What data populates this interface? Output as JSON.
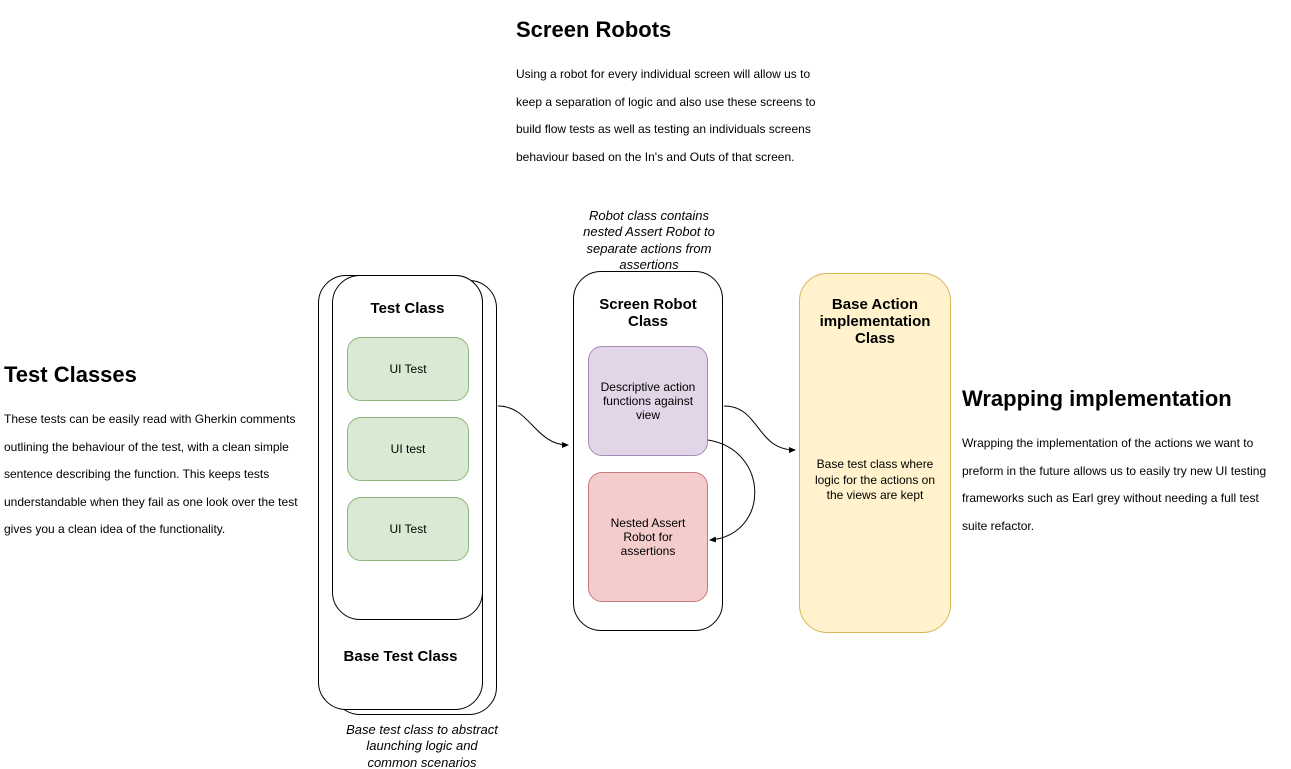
{
  "screenRobots": {
    "title": "Screen Robots",
    "body": "Using a robot for every individual screen will allow us to keep a separation of logic and also use these screens to build flow tests as well as testing an individuals screens behaviour based on the In's and Outs of that screen."
  },
  "testClasses": {
    "title": "Test Classes",
    "body": "These tests can be easily read with Gherkin comments outlining the behaviour of the test, with a clean simple sentence describing the function. This keeps tests understandable when they fail as one look over the test gives you a clean idea of the functionality."
  },
  "wrapping": {
    "title": "Wrapping implementation",
    "body": "Wrapping the implementation of the actions we want to preform in the future allows us to easily try new UI testing frameworks such as Earl grey without needing a full test suite refactor."
  },
  "testClassCard": {
    "title": "Test Class",
    "items": [
      "UI Test",
      "UI test",
      "UI Test"
    ]
  },
  "baseTestCard": {
    "title": "Base Test Class",
    "note": "Base test class to abstract launching logic and common scenarios"
  },
  "robotCard": {
    "title": "Screen Robot Class",
    "note": "Robot class contains nested Assert Robot to separate actions from assertions",
    "action": "Descriptive action functions against view",
    "assert": "Nested Assert Robot for assertions"
  },
  "baseActionCard": {
    "title": "Base Action implementation Class",
    "body": "Base test class where logic for the actions on the views are kept"
  }
}
